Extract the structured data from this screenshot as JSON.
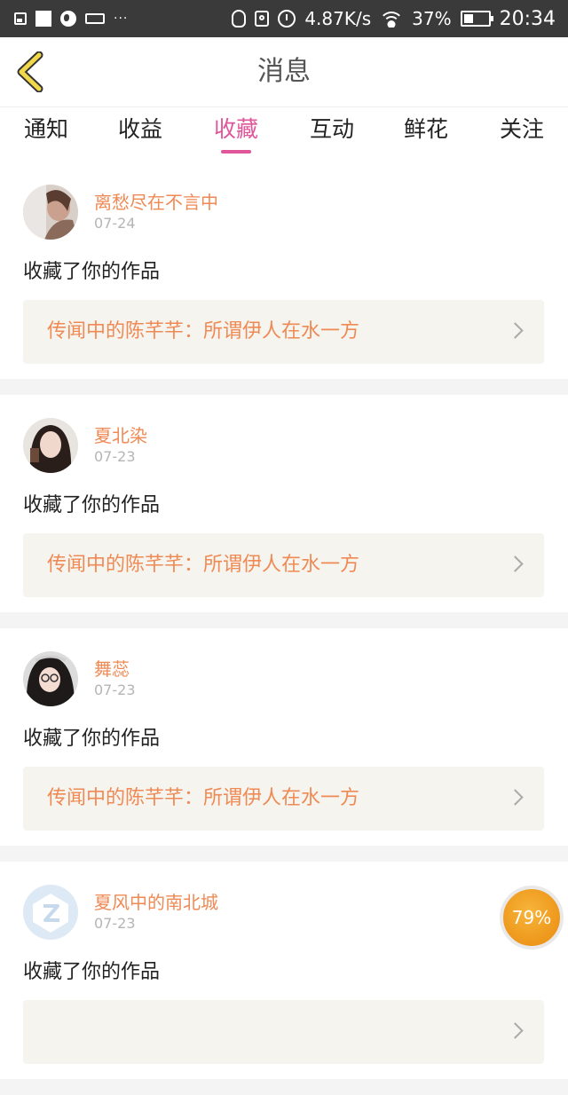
{
  "status_bar": {
    "speed": "4.87K/s",
    "battery_percent": "37%",
    "time": "20:34",
    "more": "···",
    "card_label": "SIM"
  },
  "header": {
    "title": "消息"
  },
  "tabs": [
    {
      "label": "通知",
      "active": false
    },
    {
      "label": "收益",
      "active": false
    },
    {
      "label": "收藏",
      "active": true
    },
    {
      "label": "互动",
      "active": false
    },
    {
      "label": "鲜花",
      "active": false
    },
    {
      "label": "关注",
      "active": false
    }
  ],
  "messages": [
    {
      "user": "离愁尽在不言中",
      "date": "07-24",
      "action": "收藏了你的作品",
      "work": "传闻中的陈芊芊：所谓伊人在水一方"
    },
    {
      "user": "夏北染",
      "date": "07-23",
      "action": "收藏了你的作品",
      "work": "传闻中的陈芊芊：所谓伊人在水一方"
    },
    {
      "user": "舞蕊",
      "date": "07-23",
      "action": "收藏了你的作品",
      "work": "传闻中的陈芊芊：所谓伊人在水一方"
    },
    {
      "user": "夏风中的南北城",
      "date": "07-23",
      "action": "收藏了你的作品",
      "work": ""
    }
  ],
  "floating_progress": {
    "label": "79%",
    "value": 0.79
  },
  "colors": {
    "accent": "#e0569a",
    "username": "#ef8a55",
    "card_bg": "#f5f4ef",
    "back_icon": "#f0d84a"
  }
}
